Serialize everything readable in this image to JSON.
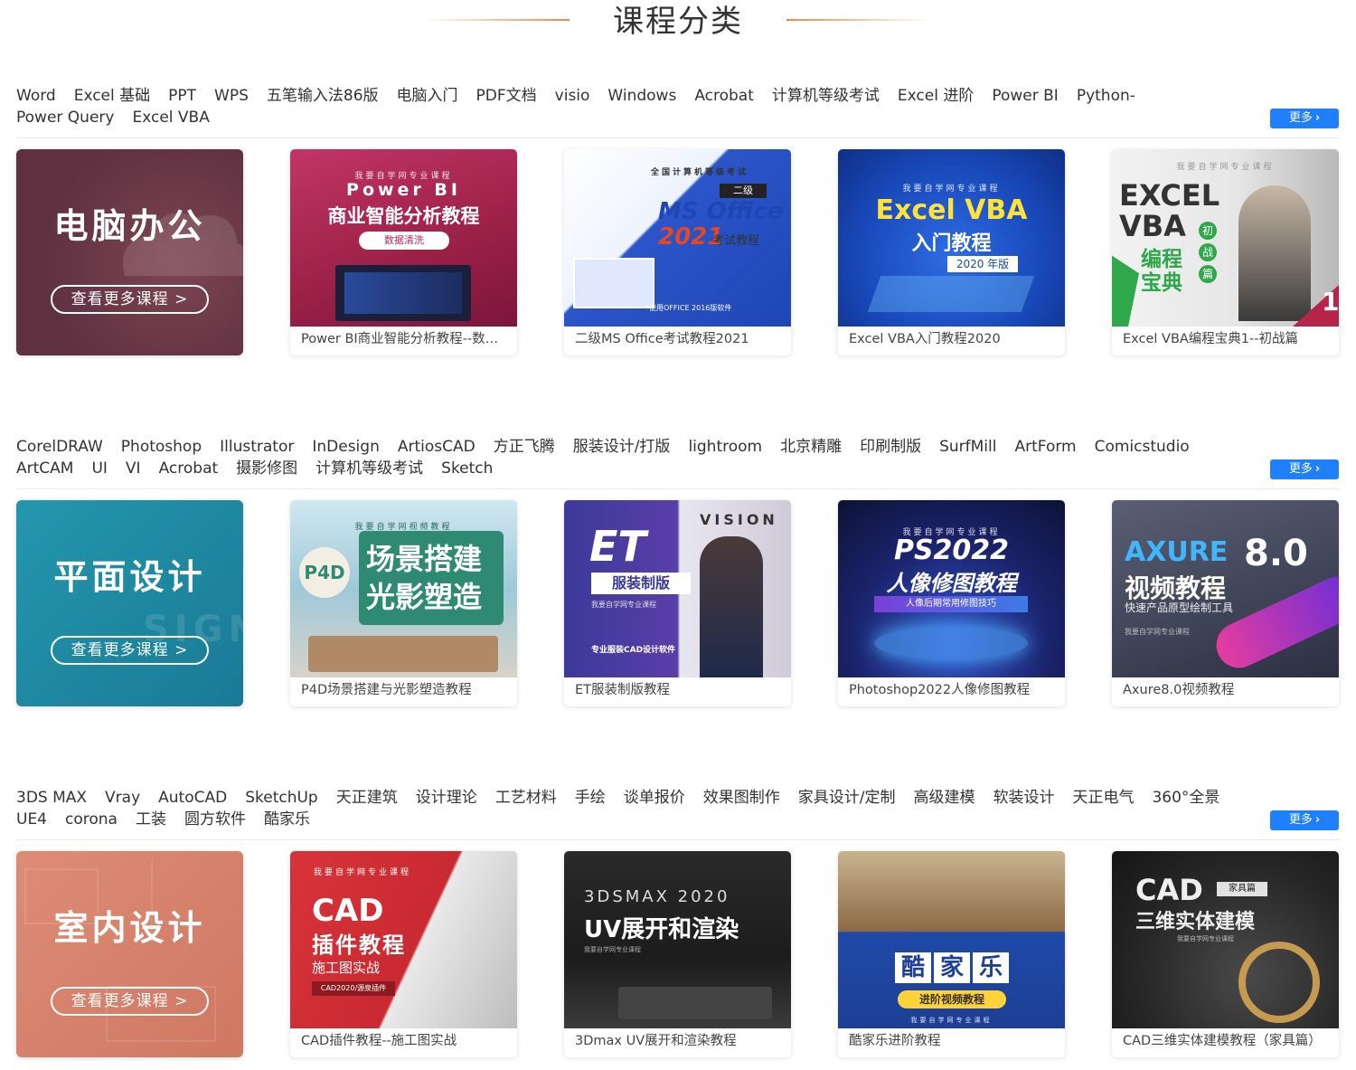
{
  "header": {
    "title": "课程分类"
  },
  "sections": [
    {
      "tags": [
        "Word",
        "Excel 基础",
        "PPT",
        "WPS",
        "五笔输入法86版",
        "电脑入门",
        "PDF文档",
        "visio",
        "Windows",
        "Acrobat",
        "计算机等级考试",
        "Excel 进阶",
        "Power BI",
        "Python-",
        "Power Query",
        "Excel VBA"
      ],
      "more_label": "更多",
      "category": {
        "title": "电脑办公",
        "button": "查看更多课程 >",
        "color": "#6e3947"
      },
      "courses": [
        {
          "caption": "Power BI商业智能分析教程--数据清洗",
          "thumb_lines": [
            "我要自学网专业课程",
            "Power BI",
            "商业智能分析教程",
            "数据清洗"
          ]
        },
        {
          "caption": "二级MS Office考试教程2021",
          "thumb_lines": [
            "全国计算机等级考试",
            "二级",
            "MS Office",
            "2021",
            "考试教程",
            "*使用OFFICE 2016版软件"
          ]
        },
        {
          "caption": "Excel VBA入门教程2020",
          "thumb_lines": [
            "我要自学网专业课程",
            "Excel VBA",
            "入门教程",
            "2020 年版"
          ]
        },
        {
          "caption": "Excel VBA编程宝典1--初战篇",
          "thumb_lines": [
            "我要自学网专业课程",
            "EXCEL",
            "VBA",
            "编程",
            "宝典",
            "初",
            "战",
            "篇",
            "1"
          ]
        }
      ]
    },
    {
      "tags": [
        "CorelDRAW",
        "Photoshop",
        "Illustrator",
        "InDesign",
        "ArtiosCAD",
        "方正飞腾",
        "服装设计/打版",
        "lightroom",
        "北京精雕",
        "印刷制版",
        "SurfMill",
        "ArtForm",
        "Comicstudio",
        "ArtCAM",
        "UI",
        "VI",
        "Acrobat",
        "摄影修图",
        "计算机等级考试",
        "Sketch"
      ],
      "more_label": "更多",
      "category": {
        "title": "平面设计",
        "button": "查看更多课程 >",
        "color": "#1f8aa3"
      },
      "courses": [
        {
          "caption": "P4D场景搭建与光影塑造教程",
          "thumb_lines": [
            "我要自学网视频教程",
            "P4D",
            "场景搭建",
            "光影塑造"
          ]
        },
        {
          "caption": "ET服装制版教程",
          "thumb_lines": [
            "VISION",
            "ET",
            "服装制版",
            "我要自学网专业课程",
            "专业服装CAD设计软件"
          ]
        },
        {
          "caption": "Photoshop2022人像修图教程",
          "thumb_lines": [
            "我要自学网专业课程",
            "PS2022",
            "人像修图教程",
            "人像后期常用修图技巧"
          ]
        },
        {
          "caption": "Axure8.0视频教程",
          "thumb_lines": [
            "AXURE",
            "8.0",
            "视频教程",
            "快速产品原型绘制工具",
            "我要自学网专业课程"
          ]
        }
      ]
    },
    {
      "tags": [
        "3DS MAX",
        "Vray",
        "AutoCAD",
        "SketchUp",
        "天正建筑",
        "设计理论",
        "工艺材料",
        "手绘",
        "谈单报价",
        "效果图制作",
        "家具设计/定制",
        "高级建模",
        "软装设计",
        "天正电气",
        "360°全景",
        "UE4",
        "corona",
        "工装",
        "圆方软件",
        "酷家乐"
      ],
      "more_label": "更多",
      "category": {
        "title": "室内设计",
        "button": "查看更多课程 >",
        "color": "#d9836d"
      },
      "courses": [
        {
          "caption": "CAD插件教程--施工图实战",
          "thumb_lines": [
            "我要自学网专业课程",
            "CAD",
            "插件教程",
            "施工图实战",
            "CAD2020/源泉插件"
          ]
        },
        {
          "caption": "3Dmax UV展开和渲染教程",
          "thumb_lines": [
            "3DSMAX 2020",
            "UV展开和渲染",
            "我要自学网专业课程"
          ]
        },
        {
          "caption": "酷家乐进阶教程",
          "thumb_lines": [
            "酷",
            "家",
            "乐",
            "进阶视频教程",
            "我要自学网专业课程"
          ]
        },
        {
          "caption": "CAD三维实体建模教程（家具篇）",
          "thumb_lines": [
            "CAD",
            "家具篇",
            "三维实体建模",
            "我要自学网专业课程"
          ]
        }
      ]
    }
  ]
}
